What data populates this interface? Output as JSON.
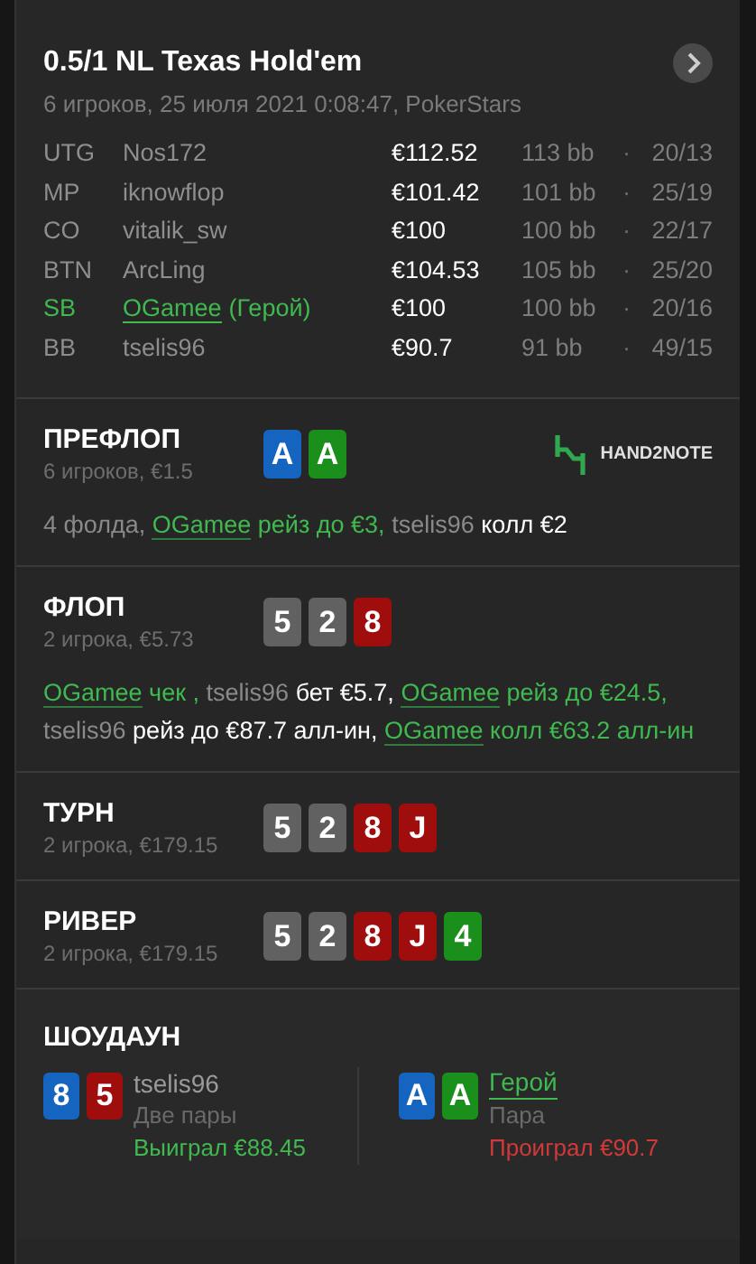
{
  "header": {
    "title": "0.5/1 NL Texas Hold'em",
    "subtitle": "6 игроков, 25 июля 2021 0:08:47, PokerStars"
  },
  "players": [
    {
      "position": "UTG",
      "name": "Nos172",
      "hero": false,
      "stack": "€112.52",
      "bb": "113 bb",
      "separator": "·",
      "stats": "20/13"
    },
    {
      "position": "MP",
      "name": "iknowflop",
      "hero": false,
      "stack": "€101.42",
      "bb": "101 bb",
      "separator": "·",
      "stats": "25/19"
    },
    {
      "position": "CO",
      "name": "vitalik_sw",
      "hero": false,
      "stack": "€100",
      "bb": "100 bb",
      "separator": "·",
      "stats": "22/17"
    },
    {
      "position": "BTN",
      "name": "ArcLing",
      "hero": false,
      "stack": "€104.53",
      "bb": "105 bb",
      "separator": "·",
      "stats": "25/20"
    },
    {
      "position": "SB",
      "name": "OGamee",
      "tag": "(Герой)",
      "hero": true,
      "stack": "€100",
      "bb": "100 bb",
      "separator": "·",
      "stats": "20/16"
    },
    {
      "position": "BB",
      "name": "tselis96",
      "hero": false,
      "stack": "€90.7",
      "bb": "91 bb",
      "separator": "·",
      "stats": "49/15"
    }
  ],
  "streets": [
    {
      "title": "ПРЕФЛОП",
      "info": "6 игроков, €1.5",
      "logo": "HAND2NOTE",
      "cards": [
        {
          "rank": "A",
          "color": "#1565c0"
        },
        {
          "rank": "A",
          "color": "#1b8f1b"
        }
      ],
      "actions": [
        {
          "kind": "muted",
          "text": "4 фолда,"
        },
        {
          "kind": "link",
          "text": "OGamee"
        },
        {
          "kind": "hero",
          "text": "рейз до €3,"
        },
        {
          "kind": "muted",
          "text": "tselis96"
        },
        {
          "kind": "strong",
          "text": "колл €2"
        }
      ]
    },
    {
      "title": "ФЛОП",
      "info": "2 игрока, €5.73",
      "cards": [
        {
          "rank": "5",
          "color": "#616161"
        },
        {
          "rank": "2",
          "color": "#616161"
        },
        {
          "rank": "8",
          "color": "#a00d0d"
        }
      ],
      "actions": [
        {
          "kind": "link",
          "text": "OGamee"
        },
        {
          "kind": "hero",
          "text": "чек ,"
        },
        {
          "kind": "muted",
          "text": "tselis96"
        },
        {
          "kind": "strong",
          "text": "бет €5.7,"
        },
        {
          "kind": "link",
          "text": "OGamee"
        },
        {
          "kind": "hero",
          "text": "рейз до €24.5,"
        },
        {
          "kind": "muted",
          "text": "tselis96"
        },
        {
          "kind": "strong",
          "text": "рейз до €87.7 алл-ин,"
        },
        {
          "kind": "link",
          "text": "OGamee"
        },
        {
          "kind": "hero",
          "text": "колл €63.2 алл-ин"
        }
      ]
    },
    {
      "title": "ТУРН",
      "info": "2 игрока, €179.15",
      "cards": [
        {
          "rank": "5",
          "color": "#616161"
        },
        {
          "rank": "2",
          "color": "#616161"
        },
        {
          "rank": "8",
          "color": "#a00d0d"
        },
        {
          "rank": "J",
          "color": "#a00d0d"
        }
      ]
    },
    {
      "title": "РИВЕР",
      "info": "2 игрока, €179.15",
      "cards": [
        {
          "rank": "5",
          "color": "#616161"
        },
        {
          "rank": "2",
          "color": "#616161"
        },
        {
          "rank": "8",
          "color": "#a00d0d"
        },
        {
          "rank": "J",
          "color": "#a00d0d"
        },
        {
          "rank": "4",
          "color": "#1b8f1b"
        }
      ]
    }
  ],
  "showdown": {
    "title": "ШОУДАУН",
    "hands": [
      {
        "name": "tselis96",
        "hero": false,
        "hand": "Две пары",
        "result": "Выиграл €88.45",
        "won": true,
        "cards": [
          {
            "rank": "8",
            "color": "#1565c0"
          },
          {
            "rank": "5",
            "color": "#a00d0d"
          }
        ]
      },
      {
        "name": "Герой",
        "hero": true,
        "hand": "Пара",
        "result": "Проиграл €90.7",
        "won": false,
        "cards": [
          {
            "rank": "A",
            "color": "#1565c0"
          },
          {
            "rank": "A",
            "color": "#1b8f1b"
          }
        ]
      }
    ]
  }
}
